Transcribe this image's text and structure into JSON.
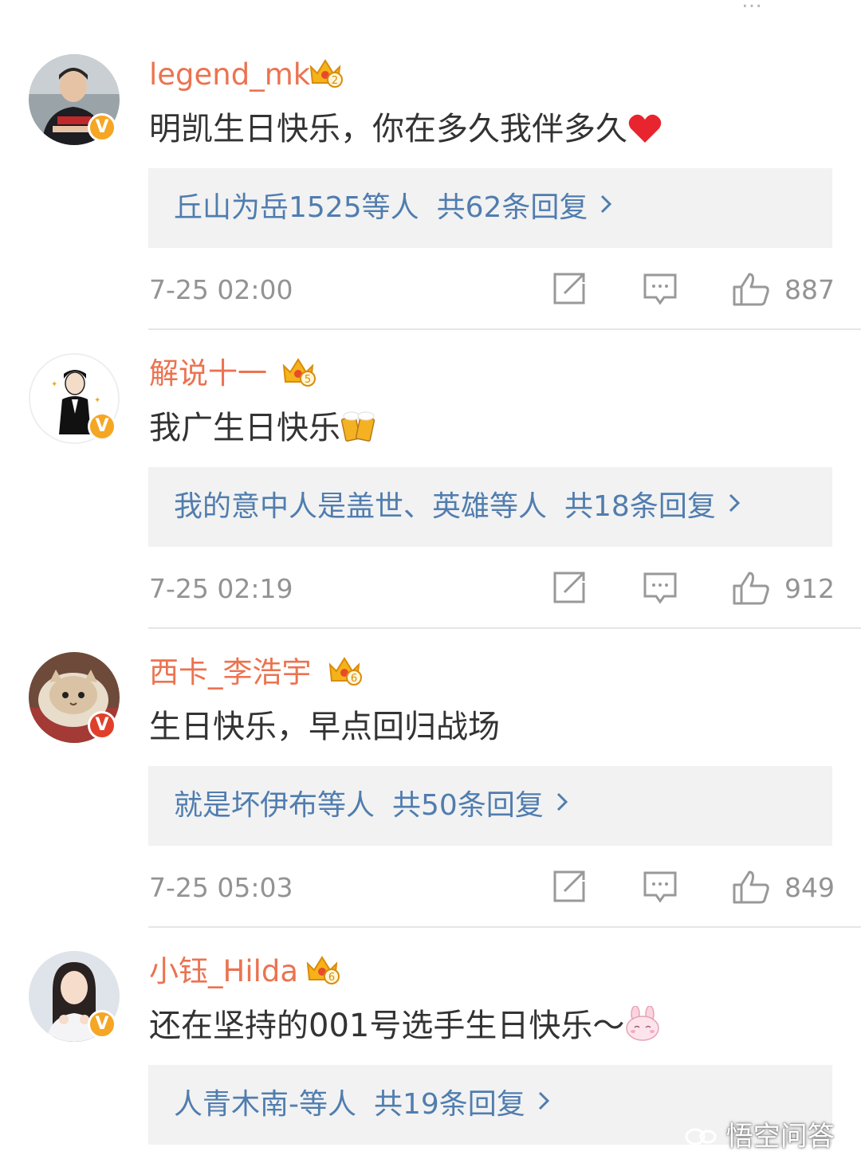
{
  "top_cut_text": "…",
  "comments": [
    {
      "username": "legend_mk",
      "crown_level": "2",
      "text": "明凯生日快乐，你在多久我伴多久",
      "emoji": "heart",
      "reply_users": "丘山为岳1525等人",
      "reply_count": "共62条回复",
      "time": "7-25 02:00",
      "likes": "887",
      "badge_color": "#f5a623"
    },
    {
      "username": "解说十一",
      "crown_level": "5",
      "text": "我广生日快乐",
      "emoji": "beer",
      "reply_users": "我的意中人是盖世、英雄等人",
      "reply_count": "共18条回复",
      "time": "7-25 02:19",
      "likes": "912",
      "badge_color": "#f5a623"
    },
    {
      "username": "西卡_李浩宇",
      "crown_level": "6",
      "text": "生日快乐，早点回归战场",
      "emoji": "",
      "reply_users": "就是坏伊布等人",
      "reply_count": "共50条回复",
      "time": "7-25 05:03",
      "likes": "849",
      "badge_color": "#e0402a"
    },
    {
      "username": "小钰_Hilda",
      "crown_level": "6",
      "text": "还在坚持的001号选手生日快乐～",
      "emoji": "bunny",
      "reply_users": "人青木南-等人",
      "reply_count": "共19条回复",
      "time": "",
      "likes": "",
      "badge_color": "#f5a623"
    }
  ],
  "watermark": "悟空问答",
  "colors": {
    "username": "#eb7350",
    "reply_link": "#507daf",
    "meta": "#939393",
    "reply_bg": "#f2f2f2"
  }
}
